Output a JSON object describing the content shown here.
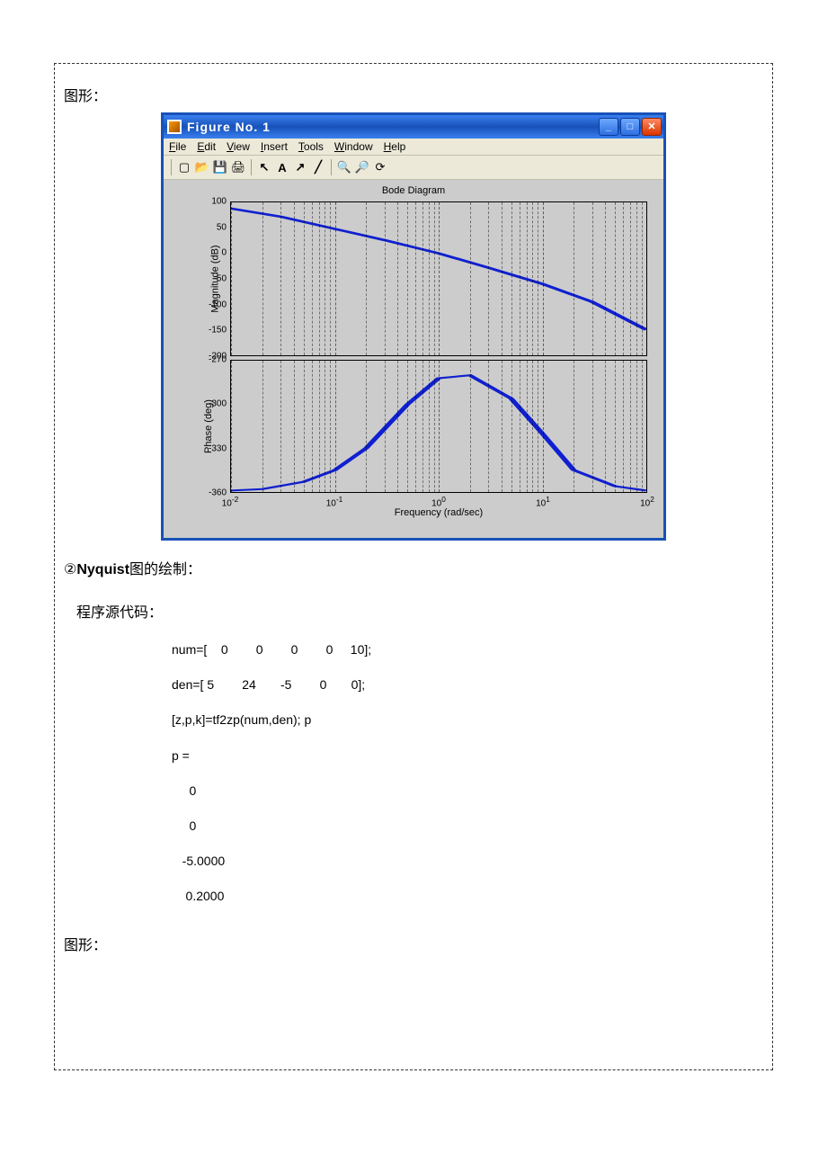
{
  "labels": {
    "figure_label_top": "图形：",
    "figure_label_bottom": "图形：",
    "nyquist_heading_prefix": "②",
    "nyquist_heading_bold": "Nyquist",
    "nyquist_heading_suffix": "图的绘制：",
    "source_code_label": "程序源代码："
  },
  "figure_window": {
    "title": "Figure No. 1",
    "menus": [
      "File",
      "Edit",
      "View",
      "Insert",
      "Tools",
      "Window",
      "Help"
    ],
    "toolbar_icons": [
      "new-file-icon",
      "open-folder-icon",
      "save-icon",
      "print-icon",
      "arrow-pointer-icon",
      "text-a-icon",
      "arrow-ne-icon",
      "line-icon",
      "zoom-in-icon",
      "zoom-out-icon",
      "rotate-icon"
    ],
    "plot_title": "Bode Diagram",
    "x_label": "Frequency  (rad/sec)",
    "mag": {
      "ylabel": "Magnitude (dB)",
      "yticks": [
        100,
        50,
        0,
        -50,
        -100,
        -150,
        -200
      ]
    },
    "phase": {
      "ylabel": "Phase (deg)",
      "yticks": [
        -270,
        -300,
        -330,
        -360
      ]
    },
    "xticks_exp": [
      -2,
      -1,
      0,
      1,
      2
    ]
  },
  "chart_data": [
    {
      "type": "line",
      "title": "Bode Diagram — Magnitude",
      "xlabel": "Frequency (rad/sec)",
      "ylabel": "Magnitude (dB)",
      "x_scale": "log",
      "xlim": [
        0.01,
        100
      ],
      "ylim": [
        -200,
        100
      ],
      "series": [
        {
          "name": "Magnitude",
          "x": [
            0.01,
            0.03,
            0.1,
            0.3,
            1,
            3,
            10,
            30,
            100
          ],
          "values": [
            88,
            72,
            48,
            26,
            0,
            -28,
            -60,
            -95,
            -150
          ]
        }
      ]
    },
    {
      "type": "line",
      "title": "Bode Diagram — Phase",
      "xlabel": "Frequency (rad/sec)",
      "ylabel": "Phase (deg)",
      "x_scale": "log",
      "xlim": [
        0.01,
        100
      ],
      "ylim": [
        -360,
        -270
      ],
      "series": [
        {
          "name": "Phase",
          "x": [
            0.01,
            0.02,
            0.05,
            0.1,
            0.2,
            0.5,
            1,
            2,
            5,
            10,
            20,
            50,
            100
          ],
          "values": [
            -359,
            -358,
            -353,
            -345,
            -330,
            -300,
            -282,
            -280,
            -296,
            -320,
            -345,
            -356,
            -359
          ]
        }
      ]
    }
  ],
  "code": {
    "lines": [
      "num=[    0        0        0        0     10];",
      "den=[ 5        24       -5        0       0];",
      "[z,p,k]=tf2zp(num,den); p",
      "p =",
      "     0",
      "     0",
      "   -5.0000",
      "    0.2000"
    ]
  }
}
